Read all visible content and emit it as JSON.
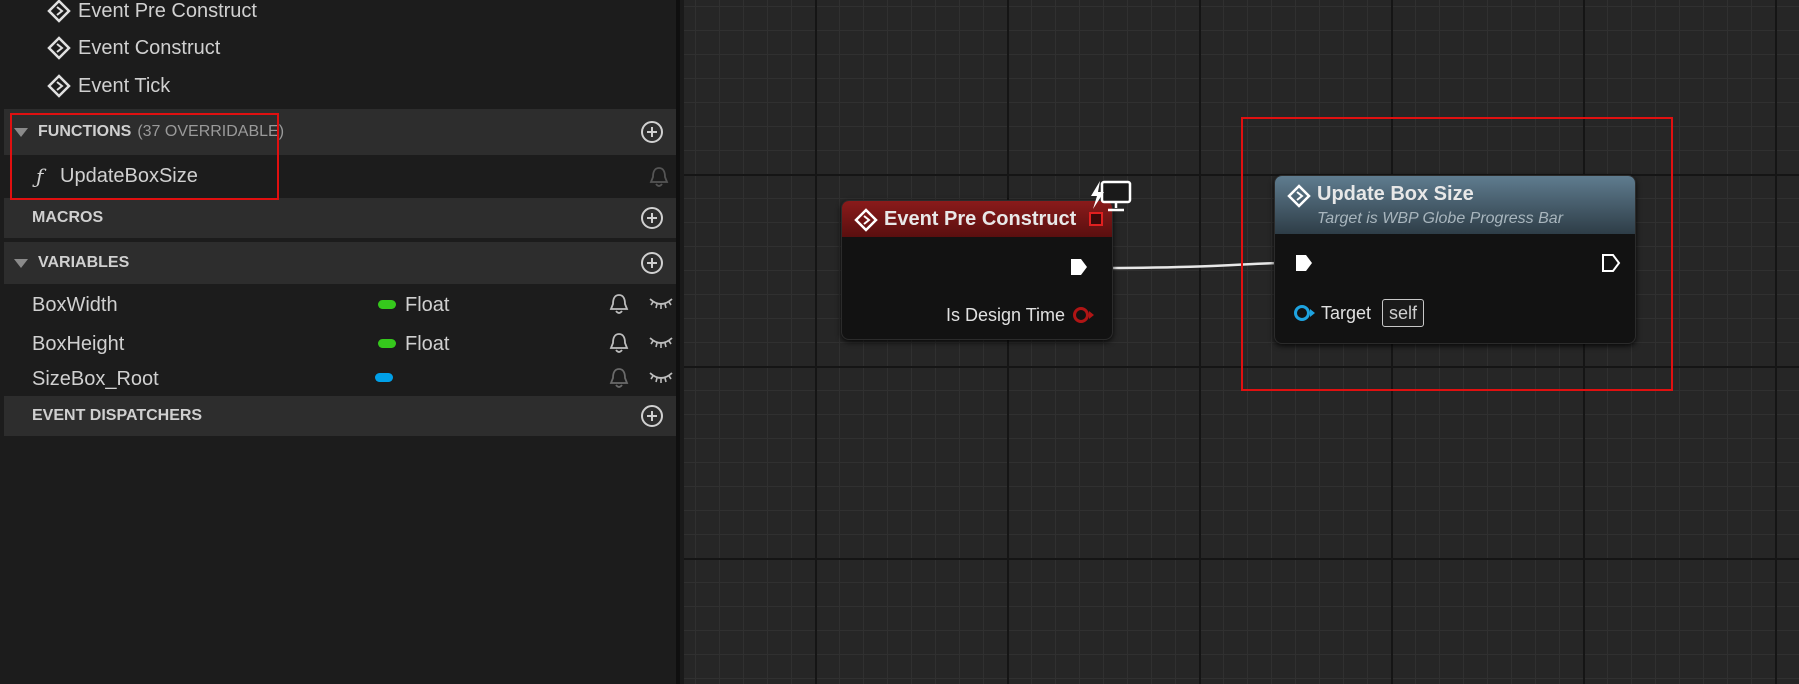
{
  "events": [
    {
      "label": "Event Pre Construct",
      "icon": "event-diamond-icon"
    },
    {
      "label": "Event Construct",
      "icon": "event-diamond-icon"
    },
    {
      "label": "Event Tick",
      "icon": "event-diamond-icon"
    }
  ],
  "functions": {
    "header": "FUNCTIONS",
    "overridable": "(37 OVERRIDABLE)",
    "items": [
      {
        "label": "UpdateBoxSize",
        "icon": "function-icon"
      }
    ]
  },
  "macros": {
    "header": "MACROS"
  },
  "variables": {
    "header": "VARIABLES",
    "items": [
      {
        "name": "BoxWidth",
        "type": "Float",
        "color": "#35c81c"
      },
      {
        "name": "BoxHeight",
        "type": "Float",
        "color": "#35c81c"
      },
      {
        "name": "SizeBox_Root",
        "type": "",
        "color": "#00a0e8"
      }
    ]
  },
  "dispatchers": {
    "header": "EVENT DISPATCHERS"
  },
  "graph": {
    "event_node": {
      "title": "Event Pre Construct",
      "pin_label": "Is Design Time",
      "header_color": "#8a1b1b",
      "pin_color": "#b01515"
    },
    "function_node": {
      "title": "Update Box Size",
      "subtitle": "Target is WBP Globe Progress Bar",
      "target_label": "Target",
      "target_value": "self",
      "header_color": "#4e6879",
      "pin_color": "#1ea3e0"
    }
  },
  "colors": {
    "highlight": "#e01010"
  }
}
